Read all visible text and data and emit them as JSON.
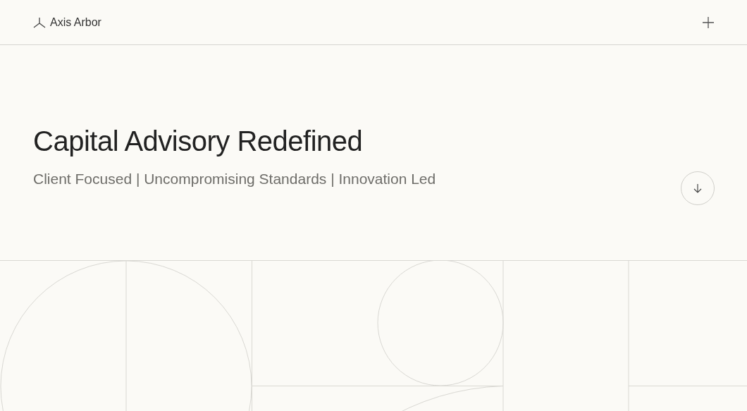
{
  "header": {
    "brand": "Axis Arbor"
  },
  "hero": {
    "title": "Capital Advisory Redefined",
    "subtitle": "Client Focused | Uncompromising Standards | Innovation Led"
  }
}
